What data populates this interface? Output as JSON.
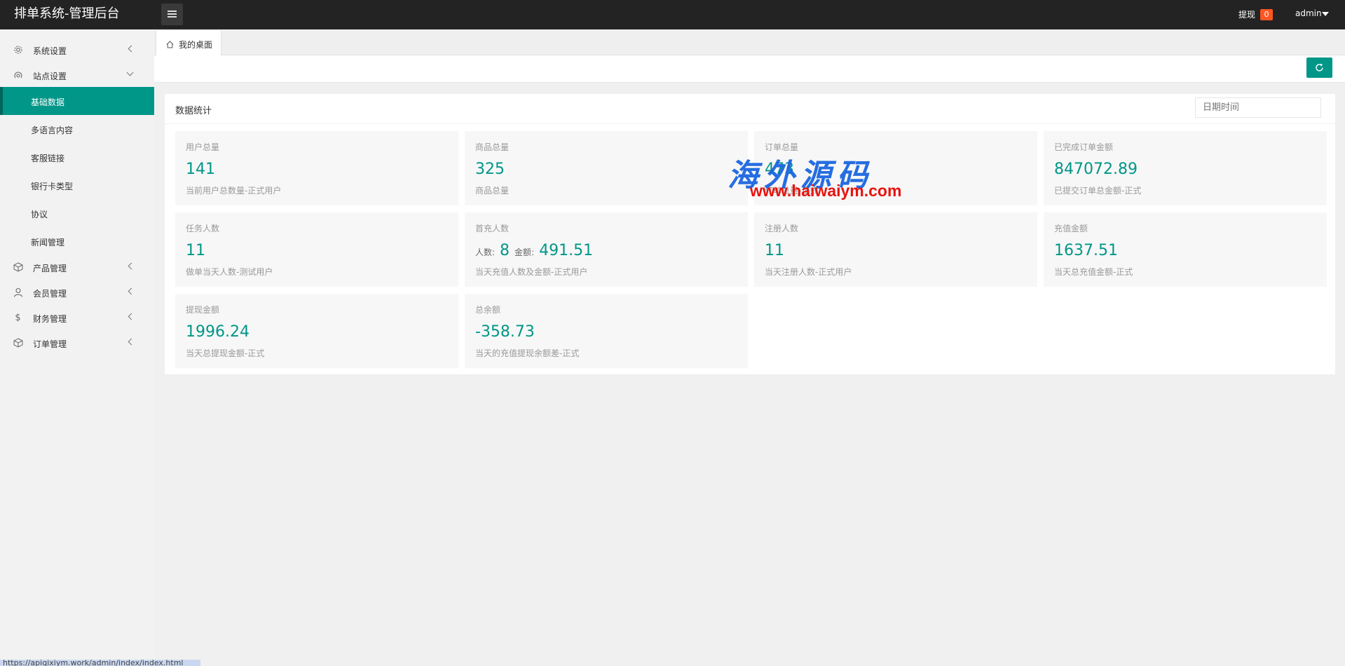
{
  "header": {
    "title": "排单系统-管理后台",
    "withdraw_label": "提现",
    "withdraw_count": "0",
    "user": "admin"
  },
  "sidebar": {
    "items": [
      {
        "label": "系统设置",
        "icon": "gear-icon"
      },
      {
        "label": "站点设置",
        "icon": "site-icon"
      },
      {
        "label": "产品管理",
        "icon": "cube-icon"
      },
      {
        "label": "会员管理",
        "icon": "user-icon"
      },
      {
        "label": "财务管理",
        "icon": "dollar-icon"
      },
      {
        "label": "订单管理",
        "icon": "box-icon"
      }
    ],
    "sub_items": [
      {
        "label": "基础数据"
      },
      {
        "label": "多语言内容"
      },
      {
        "label": "客服链接"
      },
      {
        "label": "银行卡类型"
      },
      {
        "label": "协议"
      },
      {
        "label": "新闻管理"
      }
    ]
  },
  "tabs": [
    {
      "label": "我的桌面"
    }
  ],
  "card": {
    "title": "数据统计",
    "date_placeholder": "日期时间"
  },
  "stats": [
    {
      "title": "用户总量",
      "value": "141",
      "desc": "当前用户总数量-正式用户"
    },
    {
      "title": "商品总量",
      "value": "325",
      "desc": "商品总量"
    },
    {
      "title": "订单总量",
      "value": "473",
      "desc": "订单总量-正式"
    },
    {
      "title": "已完成订单金额",
      "value": "847072.89",
      "desc": "已提交订单总金额-正式"
    },
    {
      "title": "任务人数",
      "value": "11",
      "desc": "做单当天人数-测试用户"
    },
    {
      "title": "首充人数",
      "count_label": "人数:",
      "count": "8",
      "amount_label": "金额:",
      "amount": "491.51",
      "desc": "当天充值人数及金额-正式用户"
    },
    {
      "title": "注册人数",
      "value": "11",
      "desc": "当天注册人数-正式用户"
    },
    {
      "title": "充值金额",
      "value": "1637.51",
      "desc": "当天总充值金额-正式"
    },
    {
      "title": "提现金额",
      "value": "1996.24",
      "desc": "当天总提现金额-正式"
    },
    {
      "title": "总余额",
      "value": "-358.73",
      "desc": "当天的充值提现余额差-正式"
    }
  ],
  "watermark": {
    "cn": "海外源码",
    "url": "www.haiwaiym.com"
  },
  "status_bar_url": "https://apiqixiym.work/admin/index/index.html"
}
